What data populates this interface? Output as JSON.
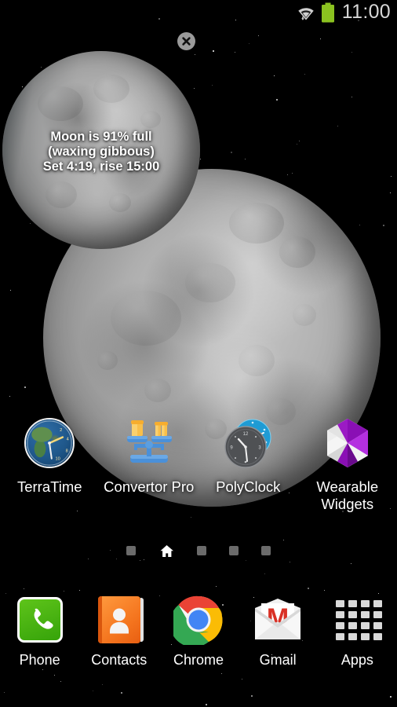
{
  "status_bar": {
    "clock": "11:00",
    "icons": [
      {
        "name": "wifi-icon",
        "label": "wifi"
      },
      {
        "name": "battery-icon",
        "label": "battery-full",
        "color": "#8bc220"
      }
    ]
  },
  "moon_widget": {
    "name": "moon-phase-widget",
    "line1": "Moon is 91% full",
    "line2": "(waxing gibbous)",
    "line3": "Set 4:19, rise 15:00",
    "close_label": "×"
  },
  "apps": [
    {
      "label": "TerraTime",
      "icon": "terratime-icon"
    },
    {
      "label": "Convertor Pro",
      "icon": "convertor-pro-icon"
    },
    {
      "label": "PolyClock",
      "icon": "polyclock-icon"
    },
    {
      "label": "Wearable Widgets",
      "icon": "wearable-widgets-icon"
    }
  ],
  "page_indicator": {
    "pages": 5,
    "current": 2,
    "home_icon": "home-icon"
  },
  "dock": [
    {
      "label": "Phone",
      "icon": "phone-icon"
    },
    {
      "label": "Contacts",
      "icon": "contacts-icon"
    },
    {
      "label": "Chrome",
      "icon": "chrome-icon"
    },
    {
      "label": "Gmail",
      "icon": "gmail-icon"
    },
    {
      "label": "Apps",
      "icon": "apps-grid-icon"
    }
  ],
  "colors": {
    "background": "#000000",
    "battery_green": "#8bc220",
    "phone_green": "#3ca70a",
    "contacts_orange": "#f4741e",
    "gmail_red": "#d93025",
    "wearable_purple": "#8a0fb5",
    "polyclock_blue": "#1f9bd4",
    "convertor_orange": "#f7b32b",
    "convertor_blue": "#4a90d9",
    "text_white": "#ffffff",
    "clock_gray": "#d8d8d8"
  }
}
